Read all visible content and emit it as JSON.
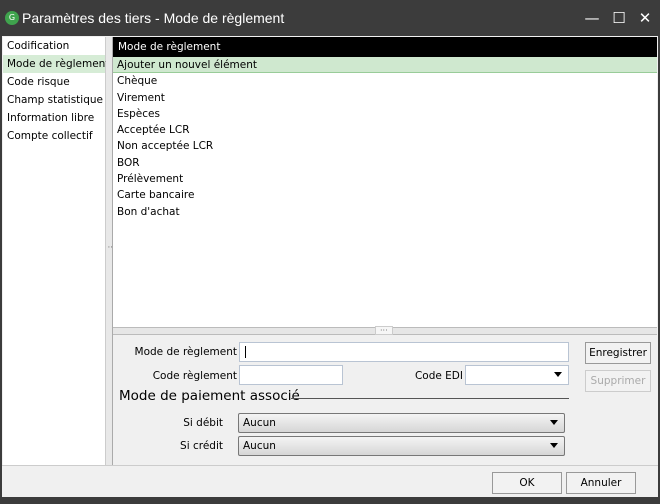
{
  "window": {
    "title": "Paramètres des tiers - Mode de règlement",
    "icon": "app-logo-icon",
    "minimize": "—",
    "maximize": "☐",
    "close": "✕"
  },
  "sidebar": {
    "items": [
      {
        "label": "Codification"
      },
      {
        "label": "Mode de règlement",
        "selected": true
      },
      {
        "label": "Code risque"
      },
      {
        "label": "Champ statistique"
      },
      {
        "label": "Information libre"
      },
      {
        "label": "Compte collectif"
      }
    ]
  },
  "list": {
    "header": "Mode de règlement",
    "add_label": "Ajouter un nouvel élément",
    "items": [
      "Chèque",
      "Virement",
      "Espèces",
      "Acceptée LCR",
      "Non acceptée LCR",
      "BOR",
      "Prélèvement",
      "Carte bancaire",
      "Bon d'achat"
    ]
  },
  "form": {
    "mode_label": "Mode de règlement",
    "mode_value": "",
    "code_label": "Code règlement",
    "code_value": "",
    "edi_label": "Code EDI",
    "edi_value": "",
    "save": "Enregistrer",
    "delete": "Supprimer",
    "section": "Mode de paiement associé",
    "debit_label": "Si débit",
    "debit_value": "Aucun",
    "credit_label": "Si crédit",
    "credit_value": "Aucun"
  },
  "footer": {
    "ok": "OK",
    "cancel": "Annuler"
  },
  "colors": {
    "selected": "#d6ecd6",
    "header": "#000000",
    "titlebar": "#3c3c3c"
  }
}
